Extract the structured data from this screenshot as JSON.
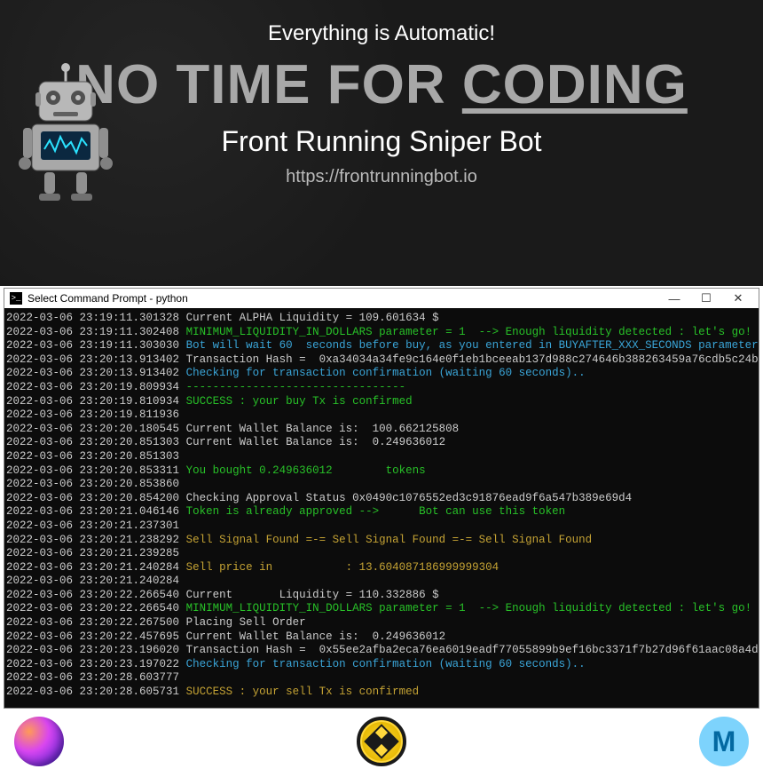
{
  "hero": {
    "top_line": "Everything is Automatic!",
    "headline_pre": "NO TIME FOR ",
    "headline_coding": "CODING",
    "subtitle": "Front Running Sniper Bot",
    "url": "https://frontrunningbot.io"
  },
  "window": {
    "title": "Select Command Prompt - python",
    "minimize": "—",
    "maximize": "☐",
    "close": "✕"
  },
  "logs": [
    {
      "ts": "2022-03-06 23:19:11.301328",
      "cls": "w",
      "msg": "Current ALPHA Liquidity = 109.601634 $"
    },
    {
      "ts": "2022-03-06 23:19:11.302408",
      "cls": "g",
      "msg": "MINIMUM_LIQUIDITY_IN_DOLLARS parameter = 1  --> Enough liquidity detected : let's go!"
    },
    {
      "ts": "2022-03-06 23:19:11.303030",
      "cls": "c",
      "msg": "Bot will wait 60  seconds before buy, as you entered in BUYAFTER_XXX_SECONDS parameter"
    },
    {
      "ts": "2022-03-06 23:20:13.913402",
      "cls": "w",
      "msg": "Transaction Hash =  0xa34034a34fe9c164e0f1eb1bceeab137d988c274646b388263459a76cdb5c24b"
    },
    {
      "ts": "2022-03-06 23:20:13.913402",
      "cls": "c",
      "msg": "Checking for transaction confirmation (waiting 60 seconds).."
    },
    {
      "ts": "2022-03-06 23:20:19.809934",
      "cls": "g",
      "msg": "---------------------------------"
    },
    {
      "ts": "2022-03-06 23:20:19.810934",
      "cls": "g",
      "msg": "SUCCESS : your buy Tx is confirmed"
    },
    {
      "ts": "2022-03-06 23:20:19.811936",
      "cls": "w",
      "msg": ""
    },
    {
      "ts": "2022-03-06 23:20:20.180545",
      "cls": "w",
      "msg": "Current Wallet Balance is:  100.662125808"
    },
    {
      "ts": "2022-03-06 23:20:20.851303",
      "cls": "w",
      "msg": "Current Wallet Balance is:  0.249636012"
    },
    {
      "ts": "2022-03-06 23:20:20.851303",
      "cls": "w",
      "msg": ""
    },
    {
      "ts": "2022-03-06 23:20:20.853311",
      "cls": "g",
      "msg": "You bought 0.249636012        tokens"
    },
    {
      "ts": "2022-03-06 23:20:20.853860",
      "cls": "w",
      "msg": ""
    },
    {
      "ts": "2022-03-06 23:20:20.854200",
      "cls": "w",
      "msg": "Checking Approval Status 0x0490c1076552ed3c91876ead9f6a547b389e69d4"
    },
    {
      "ts": "2022-03-06 23:20:21.046146",
      "cls": "g",
      "msg": "Token is already approved -->      Bot can use this token"
    },
    {
      "ts": "2022-03-06 23:20:21.237301",
      "cls": "w",
      "msg": ""
    },
    {
      "ts": "2022-03-06 23:20:21.238292",
      "cls": "y",
      "msg": "Sell Signal Found =-= Sell Signal Found =-= Sell Signal Found"
    },
    {
      "ts": "2022-03-06 23:20:21.239285",
      "cls": "w",
      "msg": ""
    },
    {
      "ts": "2022-03-06 23:20:21.240284",
      "cls": "y",
      "msg": "Sell price in           : 13.604087186999999304"
    },
    {
      "ts": "2022-03-06 23:20:21.240284",
      "cls": "w",
      "msg": ""
    },
    {
      "ts": "2022-03-06 23:20:22.266540",
      "cls": "w",
      "msg": "Current       Liquidity = 110.332886 $"
    },
    {
      "ts": "2022-03-06 23:20:22.266540",
      "cls": "g",
      "msg": "MINIMUM_LIQUIDITY_IN_DOLLARS parameter = 1  --> Enough liquidity detected : let's go!"
    },
    {
      "ts": "2022-03-06 23:20:22.267500",
      "cls": "w",
      "msg": "Placing Sell Order"
    },
    {
      "ts": "2022-03-06 23:20:22.457695",
      "cls": "w",
      "msg": "Current Wallet Balance is:  0.249636012"
    },
    {
      "ts": "2022-03-06 23:20:23.196020",
      "cls": "w",
      "msg": "Transaction Hash =  0x55ee2afba2eca76ea6019eadf77055899b9ef16bc3371f7b27d96f61aac08a4d"
    },
    {
      "ts": "2022-03-06 23:20:23.197022",
      "cls": "c",
      "msg": "Checking for transaction confirmation (waiting 60 seconds).."
    },
    {
      "ts": "2022-03-06 23:20:28.603777",
      "cls": "w",
      "msg": ""
    },
    {
      "ts": "2022-03-06 23:20:28.605731",
      "cls": "y",
      "msg": "SUCCESS : your sell Tx is confirmed"
    }
  ],
  "icons": {
    "left": "pancake-coin-icon",
    "mid": "bnb-coin-icon",
    "right": "matic-coin-icon"
  }
}
